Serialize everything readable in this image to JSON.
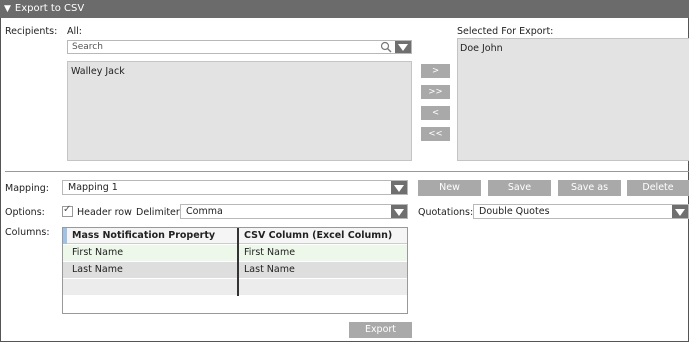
{
  "title": "Export to CSV",
  "recipients": {
    "label": "Recipients:",
    "all_label": "All:",
    "search_placeholder": "Search",
    "all_items": [
      "Walley Jack"
    ],
    "selected_label": "Selected For Export:",
    "selected_items": [
      "Doe John"
    ],
    "move_buttons": [
      ">",
      ">>",
      "<",
      "<<"
    ]
  },
  "mapping": {
    "label": "Mapping:",
    "value": "Mapping 1",
    "buttons": [
      "New",
      "Save",
      "Save as",
      "Delete"
    ]
  },
  "options": {
    "label": "Options:",
    "header_row_label": "Header row",
    "header_row_checked": true,
    "delimiter_label": "Delimiter:",
    "delimiter_value": "Comma",
    "quotations_label": "Quotations:",
    "quotations_value": "Double Quotes"
  },
  "columns": {
    "label": "Columns:",
    "headers": [
      "Mass Notification Property",
      "CSV Column  (Excel Column)"
    ],
    "rows": [
      [
        "First Name",
        "First Name"
      ],
      [
        "Last Name",
        "Last Name"
      ]
    ]
  },
  "export_label": "Export"
}
